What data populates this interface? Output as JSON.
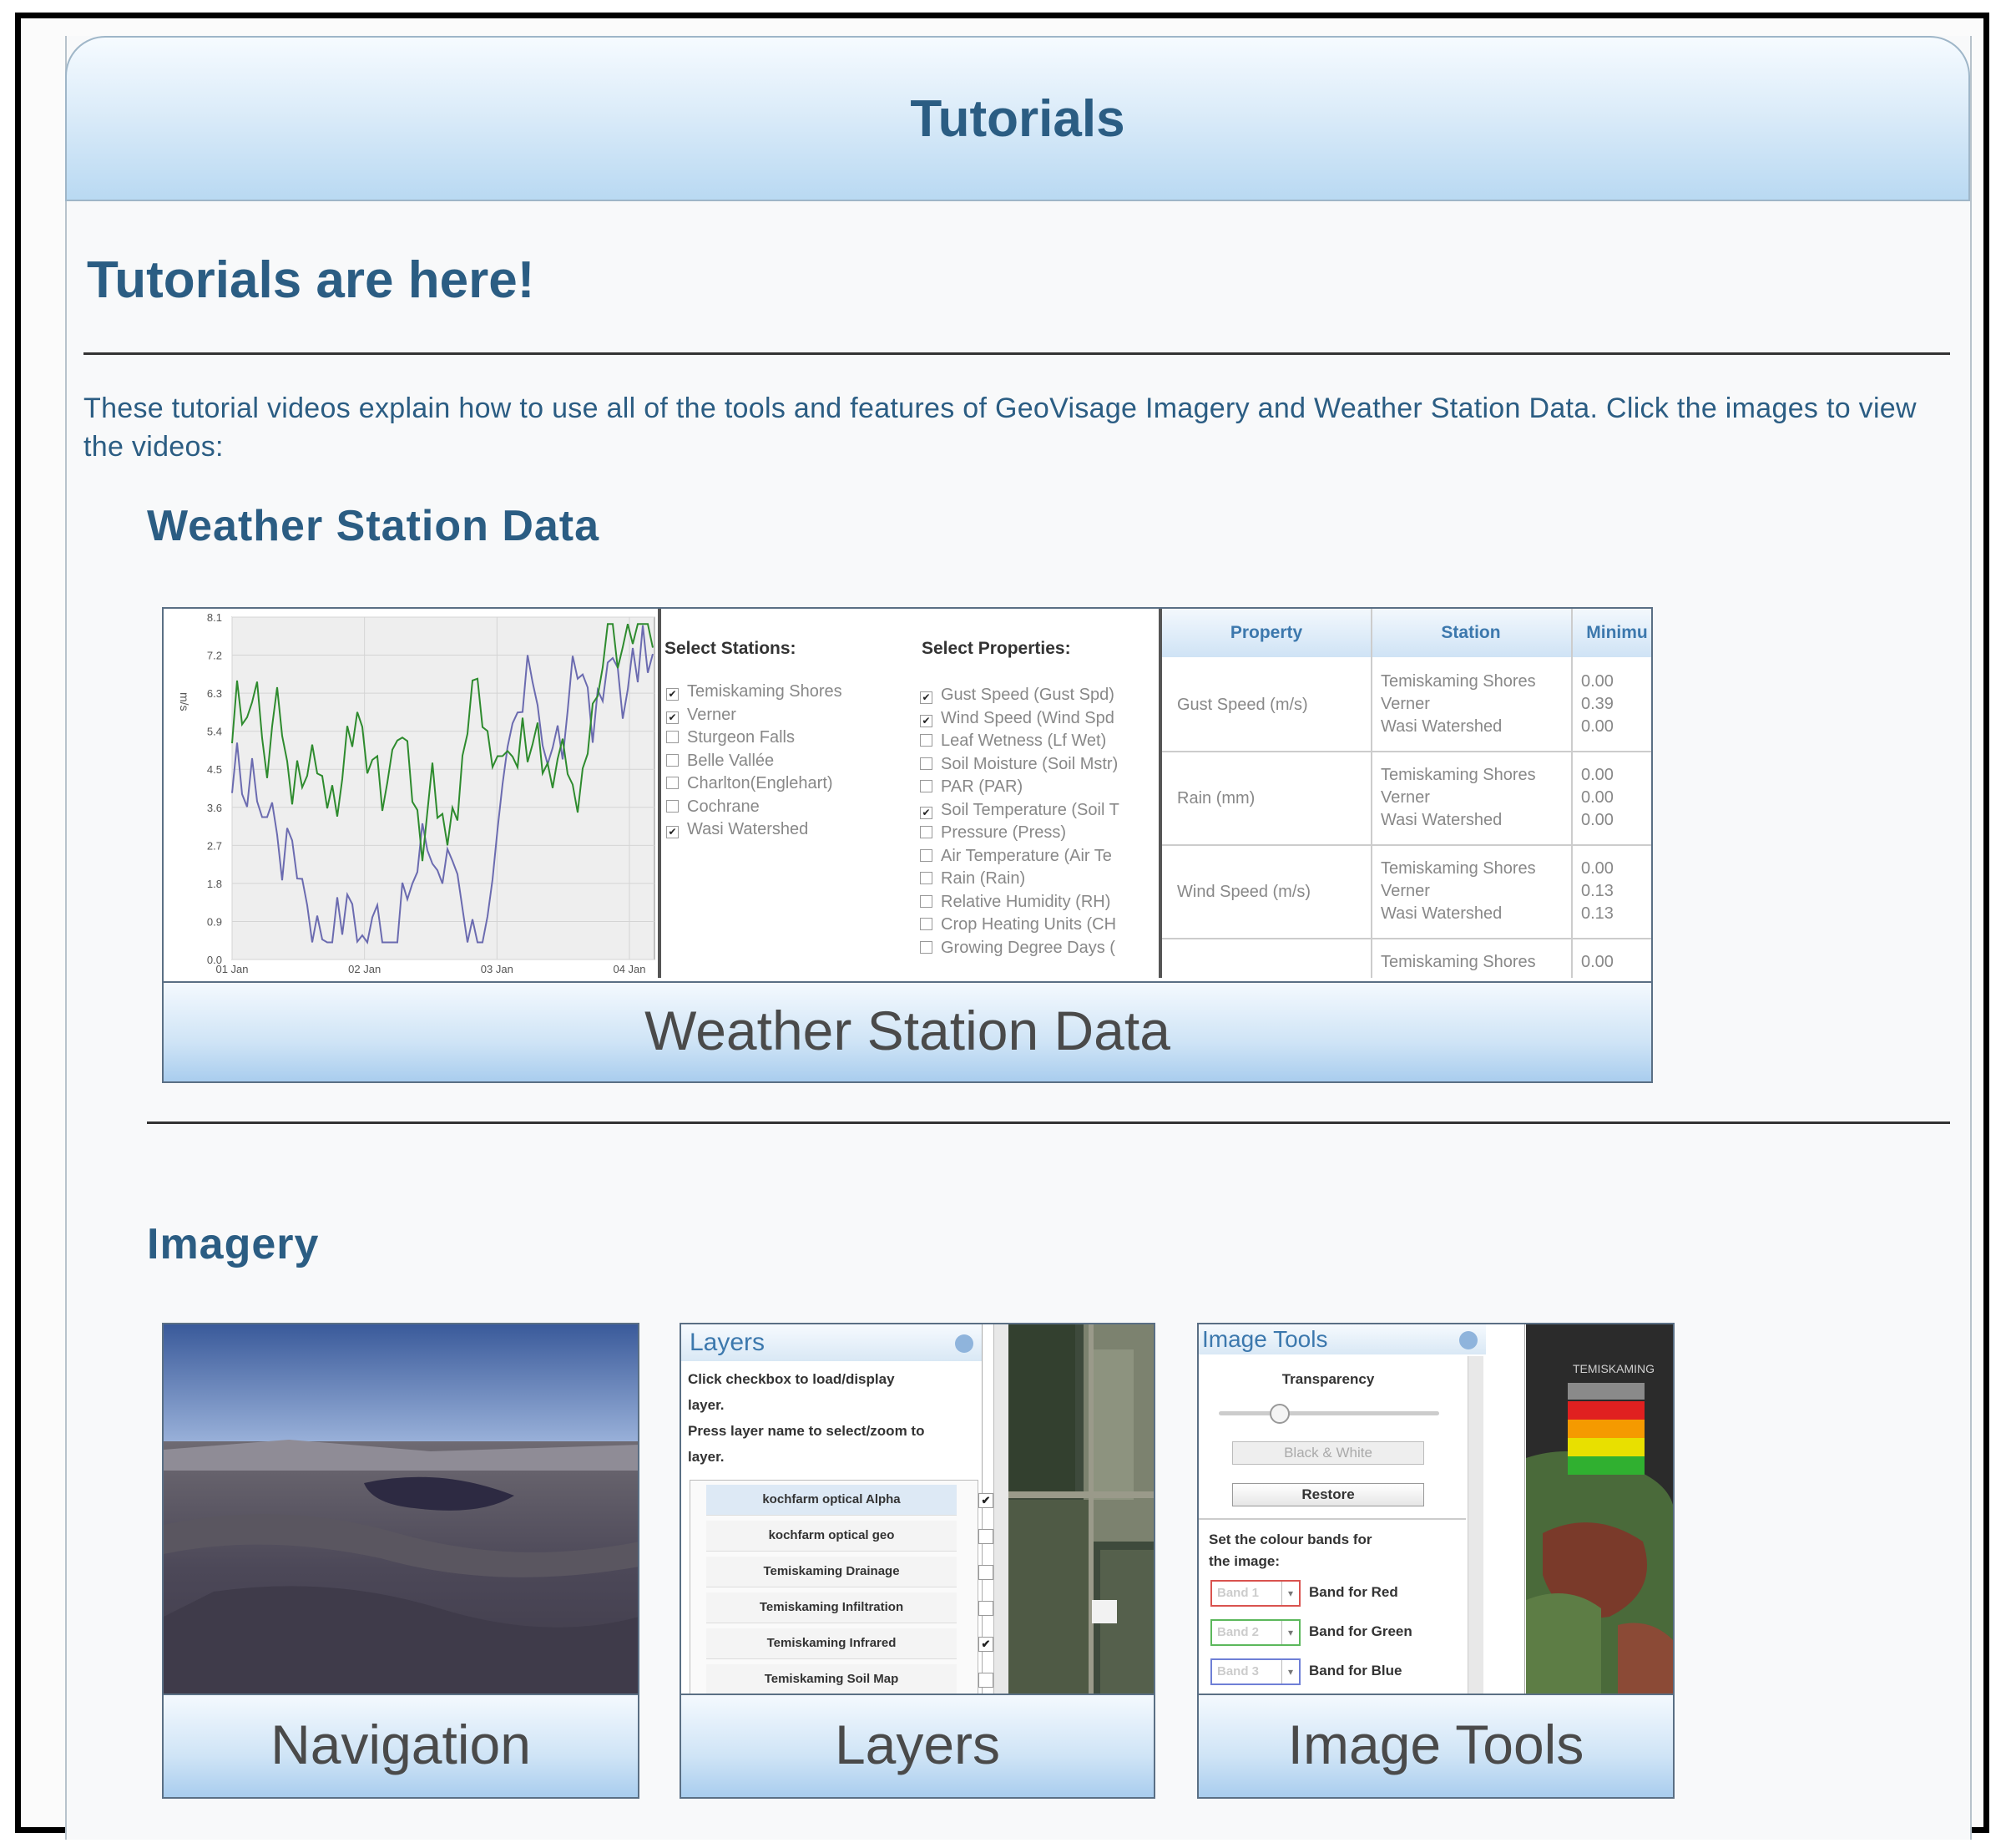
{
  "header": {
    "title": "Tutorials"
  },
  "page": {
    "heading": "Tutorials are here!",
    "intro": "These tutorial videos explain how to use all of the tools and features of GeoVisage Imagery and Weather Station Data. Click the images to view the videos:"
  },
  "weather_section": {
    "title": "Weather Station Data",
    "card_label": "Weather Station Data",
    "chart": {
      "y_ticks": [
        "8.1",
        "7.2",
        "6.3",
        "5.4",
        "4.5",
        "3.6",
        "2.7",
        "1.8",
        "0.9",
        "0.0"
      ],
      "y_unit": "m/s",
      "x_ticks": [
        "01 Jan",
        "02 Jan",
        "03 Jan",
        "04 Jan"
      ]
    },
    "stations_header": "Select Stations:",
    "stations": [
      {
        "label": "Temiskaming Shores",
        "checked": true
      },
      {
        "label": "Verner",
        "checked": true
      },
      {
        "label": "Sturgeon Falls",
        "checked": false
      },
      {
        "label": "Belle Vallée",
        "checked": false
      },
      {
        "label": "Charlton(Englehart)",
        "checked": false
      },
      {
        "label": "Cochrane",
        "checked": false
      },
      {
        "label": "Wasi Watershed",
        "checked": true
      }
    ],
    "properties_header": "Select Properties:",
    "properties": [
      {
        "label": "Gust Speed (Gust Spd)",
        "checked": true
      },
      {
        "label": "Wind Speed (Wind Spd",
        "checked": true
      },
      {
        "label": "Leaf Wetness (Lf Wet)",
        "checked": false
      },
      {
        "label": "Soil Moisture (Soil Mstr)",
        "checked": false
      },
      {
        "label": "PAR (PAR)",
        "checked": false
      },
      {
        "label": "Soil Temperature (Soil T",
        "checked": true
      },
      {
        "label": "Pressure (Press)",
        "checked": false
      },
      {
        "label": "Air Temperature (Air Te",
        "checked": false
      },
      {
        "label": "Rain (Rain)",
        "checked": false
      },
      {
        "label": "Relative Humidity (RH)",
        "checked": false
      },
      {
        "label": "Crop Heating Units (CH",
        "checked": false
      },
      {
        "label": "Growing Degree Days (",
        "checked": false
      }
    ],
    "table": {
      "headers": [
        "Property",
        "Station",
        "Minimu"
      ],
      "rows": [
        {
          "property": "Gust Speed (m/s)",
          "stations": [
            "Temiskaming Shores",
            "Verner",
            "Wasi Watershed"
          ],
          "mins": [
            "0.00",
            "0.39",
            "0.00"
          ]
        },
        {
          "property": "Rain (mm)",
          "stations": [
            "Temiskaming Shores",
            "Verner",
            "Wasi Watershed"
          ],
          "mins": [
            "0.00",
            "0.00",
            "0.00"
          ]
        },
        {
          "property": "Wind Speed (m/s)",
          "stations": [
            "Temiskaming Shores",
            "Verner",
            "Wasi Watershed"
          ],
          "mins": [
            "0.00",
            "0.13",
            "0.13"
          ]
        },
        {
          "property": "",
          "stations": [
            "Temiskaming Shores"
          ],
          "mins": [
            "0.00"
          ]
        }
      ]
    }
  },
  "imagery_section": {
    "title": "Imagery",
    "cards": [
      {
        "label": "Navigation"
      },
      {
        "label": "Layers"
      },
      {
        "label": "Image Tools"
      }
    ],
    "layers_panel": {
      "title": "Layers",
      "instructions": [
        "Click checkbox to load/display",
        "layer.",
        "Press layer name to select/zoom to",
        "layer."
      ],
      "layers": [
        {
          "name": "kochfarm optical Alpha",
          "checked": true
        },
        {
          "name": "kochfarm optical geo",
          "checked": false
        },
        {
          "name": "Temiskaming Drainage",
          "checked": false
        },
        {
          "name": "Temiskaming Infiltration",
          "checked": false
        },
        {
          "name": "Temiskaming Infrared",
          "checked": true
        },
        {
          "name": "Temiskaming Soil Map",
          "checked": false
        }
      ]
    },
    "image_tools_panel": {
      "title": "Image Tools",
      "transparency_label": "Transparency",
      "transparency_level": 0.25,
      "bw_button": "Black & White",
      "restore_button": "Restore",
      "bands_instruction": [
        "Set the colour bands for",
        "the image:"
      ],
      "bands": [
        {
          "value": "Band 1",
          "label": "Band for Red",
          "color": "#d9534f"
        },
        {
          "value": "Band 2",
          "label": "Band for Green",
          "color": "#5cb85c"
        },
        {
          "value": "Band 3",
          "label": "Band for Blue",
          "color": "#6f7fd6"
        }
      ],
      "map_overlay_text": "TEMISKAMING"
    }
  },
  "colors": {
    "heading": "#2b5d83",
    "series_green": "#2e8b2e",
    "series_purple": "#6b6bb0",
    "legend_colors": [
      "#8a8a8a",
      "#e02020",
      "#f59a00",
      "#e8e000",
      "#30b030"
    ]
  }
}
